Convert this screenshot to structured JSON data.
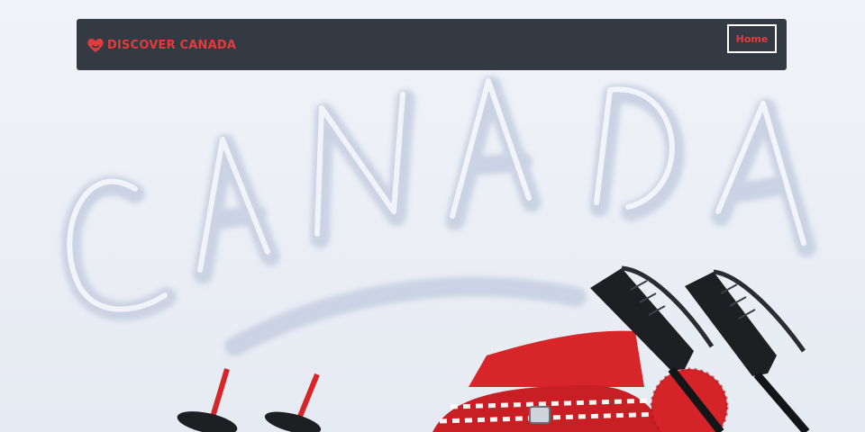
{
  "hero": {
    "image": "snow-canada-ski-poles-photo",
    "snow_text": "CANADA",
    "colors": {
      "snow": "#f4f6fb",
      "shadow": "#c9d3e6",
      "red": "#d7262a",
      "pole": "#1e1f22"
    }
  },
  "navbar": {
    "brand_icon": "heart-icon",
    "brand_label": "DISCOVER CANADA",
    "home_label": "Home",
    "colors": {
      "background": "#343a43",
      "accent": "#e23b3b",
      "border": "#ffffff"
    }
  }
}
